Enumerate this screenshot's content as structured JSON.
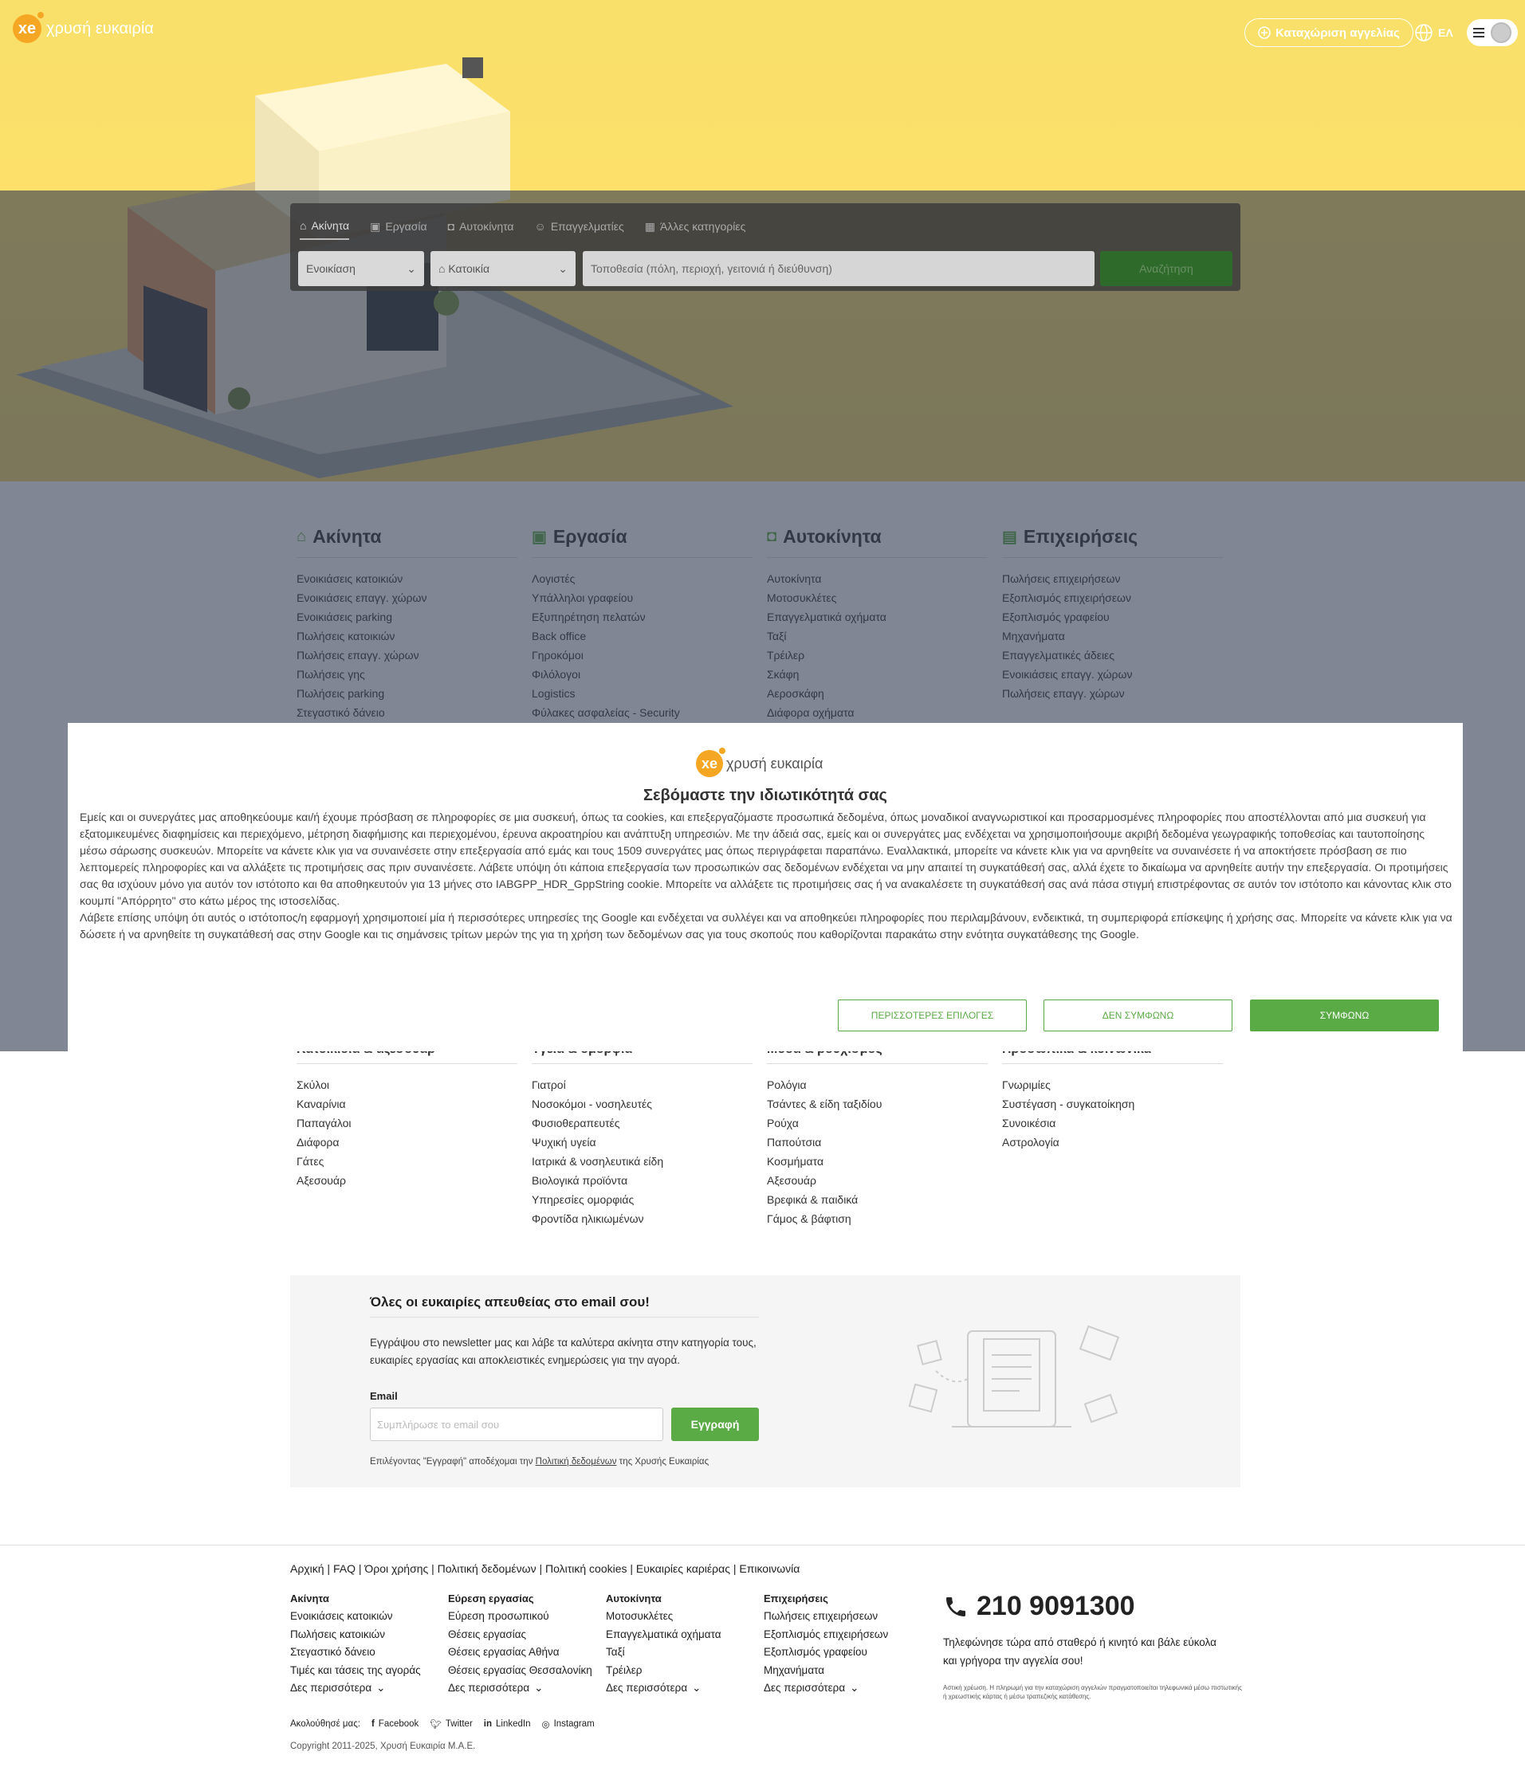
{
  "header": {
    "logo_text": "χρυσή ευκαιρία",
    "logo_badge": "xe",
    "post_button": "Καταχώριση αγγελίας",
    "language": "ΕΛ"
  },
  "search": {
    "tabs": [
      "Ακίνητα",
      "Εργασία",
      "Αυτοκίνητα",
      "Επαγγελματίες",
      "Άλλες κατηγορίες"
    ],
    "transaction": "Ενοικίαση",
    "property_type": "Κατοικία",
    "location_placeholder": "Τοποθεσία (πόλη, περιοχή, γειτονιά ή διεύθυνση)",
    "submit": "Αναζήτηση"
  },
  "categories": [
    {
      "title": "Ακίνητα",
      "icon": "home-icon",
      "items": [
        "Ενοικιάσεις κατοικιών",
        "Ενοικιάσεις επαγγ. χώρων",
        "Ενοικιάσεις parking",
        "Πωλήσεις κατοικιών",
        "Πωλήσεις επαγγ. χώρων",
        "Πωλήσεις γης",
        "Πωλήσεις parking",
        "Στεγαστικό δάνειο"
      ]
    },
    {
      "title": "Εργασία",
      "icon": "briefcase-icon",
      "items": [
        "Λογιστές",
        "Υπάλληλοι γραφείου",
        "Εξυπηρέτηση πελατών",
        "Back office",
        "Γηροκόμοι",
        "Φιλόλογοι",
        "Logistics",
        "Φύλακες ασφαλείας - Security"
      ]
    },
    {
      "title": "Αυτοκίνητα",
      "icon": "car-icon",
      "items": [
        "Αυτοκίνητα",
        "Μοτοσυκλέτες",
        "Επαγγελματικά οχήματα",
        "Ταξί",
        "Τρέιλερ",
        "Σκάφη",
        "Αεροσκάφη",
        "Διάφορα οχήματα"
      ]
    },
    {
      "title": "Επιχειρήσεις",
      "icon": "store-icon",
      "items": [
        "Πωλήσεις επιχειρήσεων",
        "Εξοπλισμός επιχειρήσεων",
        "Εξοπλισμός γραφείου",
        "Μηχανήματα",
        "Επαγγελματικές άδειες",
        "Ενοικιάσεις επαγγ. χώρων",
        "Πωλήσεις επαγγ. χώρων"
      ]
    }
  ],
  "categories2": [
    {
      "title": "Κατοικίδια & αξεσουάρ",
      "items": [
        "Σκύλοι",
        "Καναρίνια",
        "Παπαγάλοι",
        "Διάφορα",
        "Γάτες",
        "Αξεσουάρ"
      ]
    },
    {
      "title": "Υγεία & ομορφιά",
      "items": [
        "Γιατροί",
        "Νοσοκόμοι - νοσηλευτές",
        "Φυσιοθεραπευτές",
        "Ψυχική υγεία",
        "Ιατρικά & νοσηλευτικά είδη",
        "Βιολογικά προϊόντα",
        "Υπηρεσίες ομορφιάς",
        "Φροντίδα ηλικιωμένων"
      ]
    },
    {
      "title": "Μόδα & ρουχισμός",
      "items": [
        "Ρολόγια",
        "Τσάντες & είδη ταξιδίου",
        "Ρούχα",
        "Παπούτσια",
        "Κοσμήματα",
        "Αξεσουάρ",
        "Βρεφικά & παιδικά",
        "Γάμος & βάφτιση"
      ]
    },
    {
      "title": "Προσωπικά & κοινωνικά",
      "items": [
        "Γνωριμίες",
        "Συστέγαση - συγκατοίκηση",
        "Συνοικέσια",
        "Αστρολογία"
      ]
    }
  ],
  "consent": {
    "title": "Σεβόμαστε την ιδιωτικότητά σας",
    "body1": "Εμείς και οι συνεργάτες μας αποθηκεύουμε και/ή έχουμε πρόσβαση σε πληροφορίες σε μια συσκευή, όπως τα cookies, και επεξεργαζόμαστε προσωπικά δεδομένα, όπως μοναδικοί αναγνωριστικοί και προσαρμοσμένες πληροφορίες που αποστέλλονται από μια συσκευή για εξατομικευμένες διαφημίσεις και περιεχόμενο, μέτρηση διαφήμισης και περιεχομένου, έρευνα ακροατηρίου και ανάπτυξη υπηρεσιών. Με την άδειά σας, εμείς και οι συνεργάτες μας ενδέχεται να χρησιμοποιήσουμε ακριβή δεδομένα γεωγραφικής τοποθεσίας και ταυτοποίησης μέσω σάρωσης συσκευών. Μπορείτε να κάνετε κλικ για να συναινέσετε στην επεξεργασία από εμάς και τους 1509 συνεργάτες μας όπως περιγράφεται παραπάνω. Εναλλακτικά, μπορείτε να κάνετε κλικ για να αρνηθείτε να συναινέσετε ή να αποκτήσετε πρόσβαση σε πιο λεπτομερείς πληροφορίες και να αλλάξετε τις προτιμήσεις σας πριν συναινέσετε. Λάβετε υπόψη ότι κάποια επεξεργασία των προσωπικών σας δεδομένων ενδέχεται να μην απαιτεί τη συγκατάθεσή σας, αλλά έχετε το δικαίωμα να αρνηθείτε αυτήν την επεξεργασία. Οι προτιμήσεις σας θα ισχύουν μόνο για αυτόν τον ιστότοπο και θα αποθηκευτούν για 13 μήνες στο IABGPP_HDR_GppString cookie. Μπορείτε να αλλάξετε τις προτιμήσεις σας ή να ανακαλέσετε τη συγκατάθεσή σας ανά πάσα στιγμή επιστρέφοντας σε αυτόν τον ιστότοπο και κάνοντας κλικ στο κουμπί \"Απόρρητο\" στο κάτω μέρος της ιστοσελίδας.",
    "body2": "Λάβετε επίσης υπόψη ότι αυτός ο ιστότοπος/η εφαρμογή χρησιμοποιεί μία ή περισσότερες υπηρεσίες της Google και ενδέχεται να συλλέγει και να αποθηκεύει πληροφορίες που περιλαμβάνουν, ενδεικτικά, τη συμπεριφορά επίσκεψης ή χρήσης σας. Μπορείτε να κάνετε κλικ για να δώσετε ή να αρνηθείτε τη συγκατάθεσή σας στην Google και τις σημάνσεις τρίτων μερών της για τη χρήση των δεδομένων σας για τους σκοπούς που καθορίζονται παρακάτω στην ενότητα συγκατάθεσης της Google.",
    "more_options": "ΠΕΡΙΣΣΟΤΕΡΕΣ ΕΠΙΛΟΓΕΣ",
    "decline": "ΔΕΝ ΣΥΜΦΩΝΩ",
    "accept": "ΣΥΜΦΩΝΩ"
  },
  "newsletter": {
    "title": "Όλες οι ευκαιρίες απευθείας στο email σου!",
    "desc": "Εγγράψου στο newsletter μας και λάβε τα καλύτερα ακίνητα στην κατηγορία τους, ευκαιρίες εργασίας και αποκλειστικές ενημερώσεις για την αγορά.",
    "email_label": "Email",
    "email_placeholder": "Συμπλήρωσε το email σου",
    "submit": "Εγγραφή",
    "terms_pre": "Επιλέγοντας \"Εγγραφή\" αποδέχομαι την ",
    "terms_link": "Πολιτική δεδομένων",
    "terms_post": " της Χρυσής Ευκαιρίας"
  },
  "footer": {
    "links": "Αρχική | FAQ | Όροι χρήσης | Πολιτική δεδομένων | Πολιτική cookies | Ευκαιρίες καριέρας | Επικοινωνία",
    "columns": [
      {
        "title": "Ακίνητα",
        "items": [
          "Ενοικιάσεις κατοικιών",
          "Πωλήσεις κατοικιών",
          "Στεγαστικό δάνειο",
          "Τιμές και τάσεις της αγοράς"
        ]
      },
      {
        "title": "Εύρεση εργασίας",
        "items": [
          "Εύρεση προσωπικού",
          "Θέσεις εργασίας",
          "Θέσεις εργασίας Αθήνα",
          "Θέσεις εργασίας Θεσσαλονίκη"
        ]
      },
      {
        "title": "Αυτοκίνητα",
        "items": [
          "Μοτοσυκλέτες",
          "Επαγγελματικά οχήματα",
          "Ταξί",
          "Τρέιλερ"
        ]
      },
      {
        "title": "Επιχειρήσεις",
        "items": [
          "Πωλήσεις επιχειρήσεων",
          "Εξοπλισμός επιχειρήσεων",
          "Εξοπλισμός γραφείου",
          "Μηχανήματα"
        ]
      }
    ],
    "see_more": "Δες περισσότερα",
    "phone": "210 9091300",
    "phone_desc": "Τηλεφώνησε τώρα από σταθερό ή κινητό και βάλε εύκολα και γρήγορα την αγγελία σου!",
    "phone_fine": "Αστική χρέωση. Η πληρωμή για την καταχώριση αγγελιών πραγματοποιείται τηλεφωνικά μέσω πιστωτικής ή χρεωστικής κάρτας ή μέσω τραπεζικής κατάθεσης.",
    "follow_label": "Ακολούθησέ μας:",
    "social": [
      "Facebook",
      "Twitter",
      "LinkedIn",
      "Instagram"
    ],
    "copyright": "Copyright 2011-2025, Χρυσή Ευκαιρία Μ.Α.Ε."
  },
  "colors": {
    "brand": "#f5a623",
    "green": "#5aab45",
    "hero": "#fce06a"
  }
}
